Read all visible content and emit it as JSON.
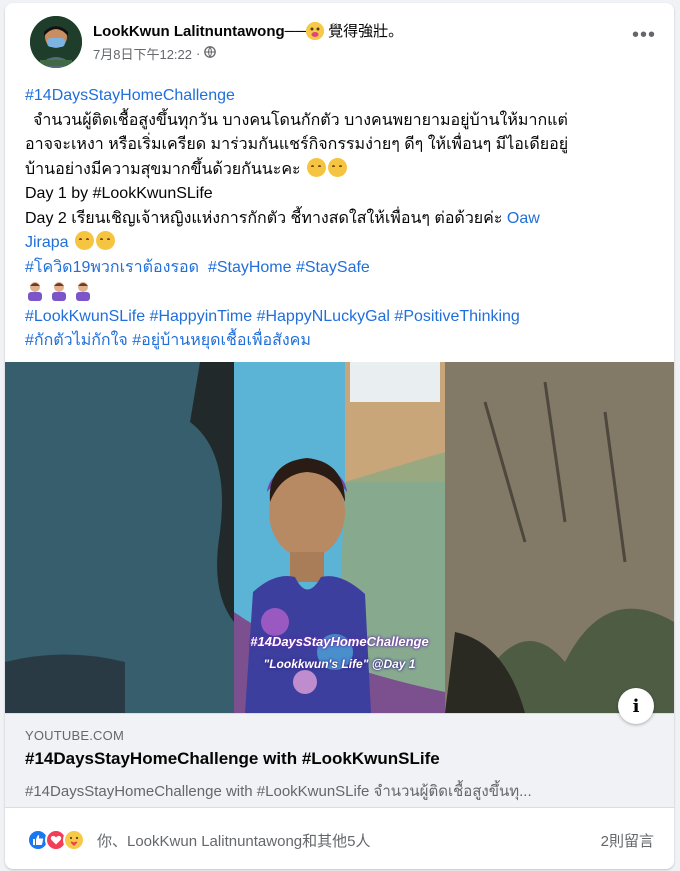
{
  "post": {
    "author": "LookKwun Lalitnuntawong",
    "feeling_text": "覺得強壯。",
    "timestamp": "7月8日下午12:22",
    "privacy_icon": "globe-icon",
    "more_icon": "more-options-icon"
  },
  "body": {
    "line1": "#14DaysStayHomeChallenge",
    "line2": "จำนวนผู้ติดเชื้อสูงขึ้นทุกวัน บางคนโดนกักตัว บางคนพยายามอยู่บ้านให้มากแต่",
    "line3": "อาจจะเหงา หรือเริ่มเครียด มาร่วมกันแชร์กิจกรรมง่ายๆ ดีๆ ให้เพื่อนๆ มีไอเดียอยู่",
    "line4": "บ้านอย่างมีความสุขมากขึ้นด้วยกันนะคะ",
    "line5": "Day 1 by ",
    "line5_tag": "#LookKwunSLife",
    "line6": "Day 2 เรียนเชิญเจ้าหญิงแห่งการกักตัว ชี้ทางสดใสให้เพื่อนๆ ต่อด้วยค่ะ ",
    "line6_mention": "Oaw",
    "line7_mention": "Jirapa",
    "tags1_a": "#โควิด19พวกเราต้องรอด",
    "tags1_b": "#StayHome",
    "tags1_c": "#StaySafe",
    "tags2_a": "#LookKwunSLife",
    "tags2_b": "#HappyinTime",
    "tags2_c": "#HappyNLuckyGal",
    "tags2_d": "#PositiveThinking",
    "tags3_a": "#กักตัวไม่กักใจ",
    "tags3_b": "#อยู่บ้านหยุดเชื้อเพื่อสังคม"
  },
  "video": {
    "caption1": "#14DaysStayHomeChallenge",
    "caption2": "\"Lookkwun's Life\" @Day 1"
  },
  "preview": {
    "domain": "YOUTUBE.COM",
    "title": "#14DaysStayHomeChallenge with #LookKwunSLife",
    "description": "#14DaysStayHomeChallenge with #LookKwunSLife จำนวนผู้ติดเชื้อสูงขึ้นทุ..."
  },
  "reactions": {
    "icons": [
      "like-icon",
      "love-icon",
      "care-icon"
    ],
    "text": "你、LookKwun Lalitnuntawong和其他5人",
    "comments": "2則留言"
  },
  "colors": {
    "link": "#216fdb",
    "secondary": "#65676b",
    "like": "#1877f2",
    "love": "#f33e58"
  }
}
